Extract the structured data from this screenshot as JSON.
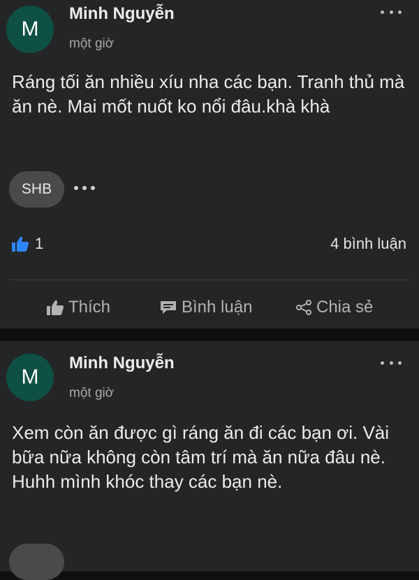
{
  "posts": [
    {
      "avatar_letter": "M",
      "author": "Minh Nguyễn",
      "time": "một giờ",
      "text": "Ráng tối ăn nhiều xíu nha các bạn. Tranh thủ mà ăn nè. Mai mốt nuốt ko nổi đâu.khà khà",
      "tag": "SHB",
      "like_count": "1",
      "comment_count": "4 bình luận"
    },
    {
      "avatar_letter": "M",
      "author": "Minh Nguyễn",
      "time": "một giờ",
      "text": "Xem còn ăn được gì ráng ăn đi các bạn ơi. Vài bữa nữa không còn tâm trí mà ăn nữa đâu nè. Huhh mình khóc thay các bạn nè."
    }
  ],
  "actions": {
    "like": "Thích",
    "comment": "Bình luận",
    "share": "Chia sẻ"
  },
  "colors": {
    "avatar": "#0e5144",
    "like_icon": "#2d88ff",
    "card": "#242526",
    "background": "#0f0f0f"
  },
  "icons": [
    "more-icon",
    "thumbs-up-icon",
    "comment-icon",
    "share-icon"
  ]
}
